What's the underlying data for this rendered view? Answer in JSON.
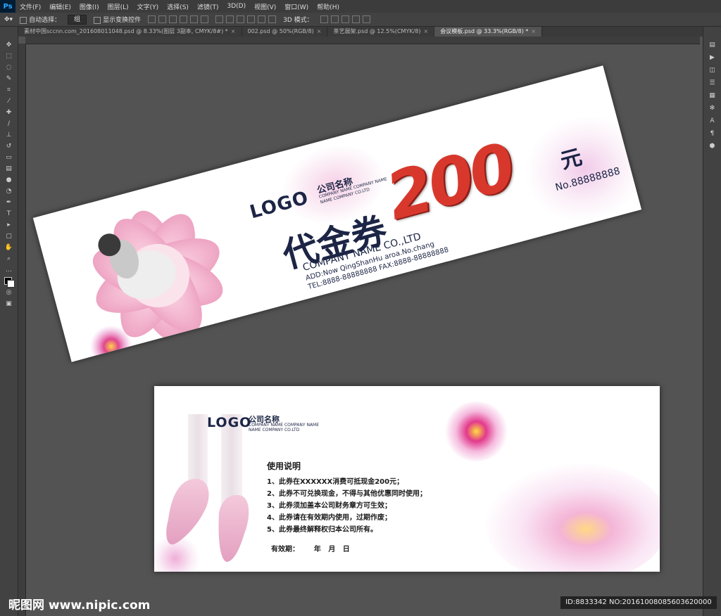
{
  "menu": [
    "文件(F)",
    "编辑(E)",
    "图像(I)",
    "图层(L)",
    "文字(Y)",
    "选择(S)",
    "滤镜(T)",
    "3D(D)",
    "视图(V)",
    "窗口(W)",
    "帮助(H)"
  ],
  "options": {
    "auto_select": "自动选择：",
    "group": "组",
    "transform": "显示变换控件",
    "mode3d": "3D 模式："
  },
  "tabs": [
    {
      "label": "素材中国sccnn.com_2016080110​48.psd @ 8.33%(图层 3副本, CMYK/8#) *",
      "active": false
    },
    {
      "label": "002.psd @ 50%(RGB/8)",
      "active": false
    },
    {
      "label": "茶艺展架.psd @ 12.5%(CMYK/8)",
      "active": false
    },
    {
      "label": "会议模板.psd @ 33.3%(RGB/8) *",
      "active": true
    }
  ],
  "front": {
    "logo": "LOGO",
    "company_cn": "公司名称",
    "company_sub1": "COMPANY NAME COMPANY NAME",
    "company_sub2": "NAME COMPANY CO.LTD",
    "title": "代金券",
    "amount": "200",
    "unit": "元",
    "serial": "No.88888888",
    "company_en": "COMPANY NAME CO.,LTD",
    "addr": "ADD:Now QingShanHu aroa.No.chang",
    "tel": "TEL:8888-88888888  FAX:8888-88888888"
  },
  "back": {
    "logo": "LOGO",
    "company_cn": "公司名称",
    "company_sub1": "COMPANY NAME COMPANY NAME",
    "company_sub2": "NAME COMPANY CO.LTD",
    "heading": "使用说明",
    "items": [
      "1、此券在XXXXXX消费可抵现金200元；",
      "2、此券不可兑换现金，不得与其他优惠同时使用；",
      "3、此券须加盖本公司财务章方可生效；",
      "4、此券请在有效期内使用，过期作废；",
      "5、此券最终解释权归本公司所有。"
    ],
    "validity": "有效期：      年   月   日"
  },
  "watermark": {
    "site": "昵图网 www.nipic.com",
    "id": "ID:8833342 NO:20161008085603620000"
  },
  "colors": {
    "navy": "#1c2545",
    "red": "#d8382c",
    "pink": "#f2b9d0"
  }
}
